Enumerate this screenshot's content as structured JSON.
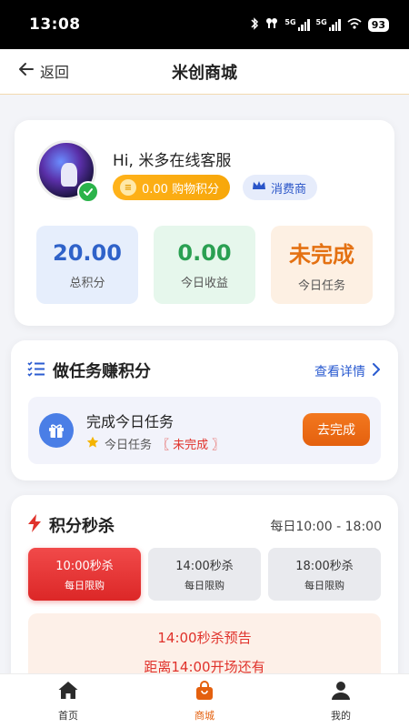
{
  "status": {
    "time": "13:08",
    "net_tag_1": "5G",
    "net_tag_2": "5G",
    "battery": "93"
  },
  "nav": {
    "back_label": "返回",
    "title": "米创商城"
  },
  "profile": {
    "greeting": "Hi, 米多在线客服",
    "points_pill": "0.00 购物积分",
    "role": "消费商",
    "stats": [
      {
        "value": "20.00",
        "label": "总积分"
      },
      {
        "value": "0.00",
        "label": "今日收益"
      },
      {
        "value": "未完成",
        "label": "今日任务"
      }
    ]
  },
  "tasks": {
    "title": "做任务赚积分",
    "view_detail": "查看详情",
    "task_title": "完成今日任务",
    "task_prefix": "今日任务",
    "task_status": "〖 未完成 〗",
    "go_button": "去完成"
  },
  "flash": {
    "title": "积分秒杀",
    "hours": "每日10:00 - 18:00",
    "slots": [
      {
        "time": "10:00秒杀",
        "sub": "每日限购"
      },
      {
        "time": "14:00秒杀",
        "sub": "每日限购"
      },
      {
        "time": "18:00秒杀",
        "sub": "每日限购"
      }
    ],
    "preview_title": "14:00秒杀预告",
    "preview_countdown": "距离14:00开场还有"
  },
  "tabbar": {
    "tabs": [
      {
        "label": "首页",
        "icon": "home-icon"
      },
      {
        "label": "商城",
        "icon": "shopping-bag-icon"
      },
      {
        "label": "我的",
        "icon": "user-icon"
      }
    ]
  },
  "colors": {
    "accent_orange": "#e4600e",
    "accent_red": "#dc2727",
    "accent_blue": "#2a5bd0",
    "gold": "#f7a70b"
  }
}
